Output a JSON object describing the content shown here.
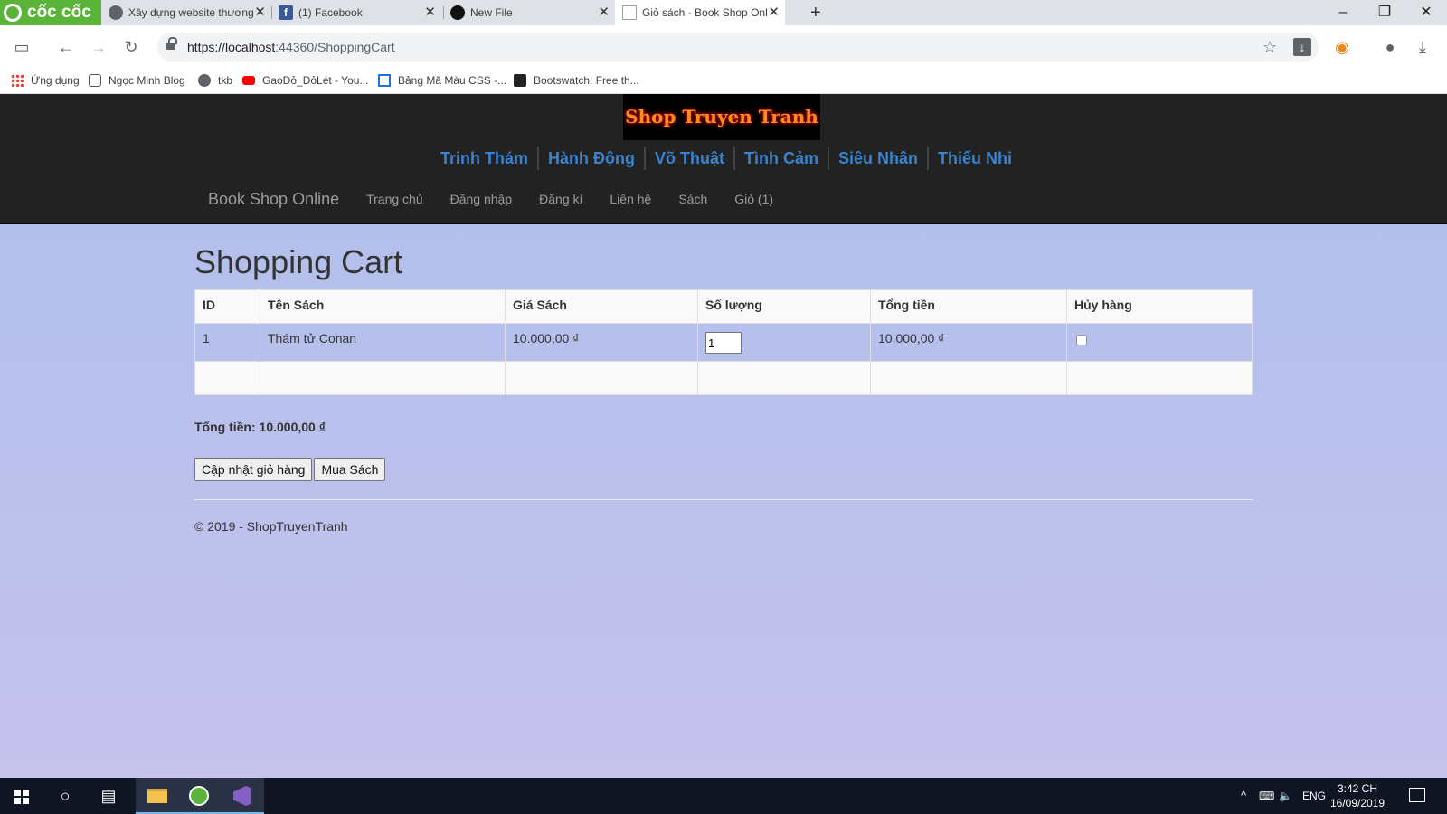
{
  "browser": {
    "brand": "cốc cốc",
    "tabs": [
      {
        "title": "Xây dựng website thương"
      },
      {
        "title": "(1) Facebook"
      },
      {
        "title": "New File"
      },
      {
        "title": "Giỏ sách - Book Shop Onl"
      }
    ],
    "url_host": "https://localhost",
    "url_rest": ":44360/ShoppingCart",
    "bookmarks": [
      {
        "label": "Ứng dụng",
        "icon": "apps-icon"
      },
      {
        "label": "Ngọc Minh Blog",
        "icon": "blog-icon"
      },
      {
        "label": "tkb",
        "icon": "globe-icon"
      },
      {
        "label": "GaoĐỏ_ĐỏLét - You...",
        "icon": "youtube-icon"
      },
      {
        "label": "Bảng Mã Màu CSS -...",
        "icon": "css-icon"
      },
      {
        "label": "Bootswatch: Free th...",
        "icon": "bootswatch-icon"
      }
    ]
  },
  "site": {
    "logo_text": "Shop Truyen Tranh",
    "categories": [
      "Trinh Thám",
      "Hành Động",
      "Võ Thuật",
      "Tình Cảm",
      "Siêu Nhân",
      "Thiếu Nhi"
    ],
    "brand": "Book Shop Online",
    "nav": [
      "Trang chủ",
      "Đăng nhập",
      "Đăng kí",
      "Liên hệ",
      "Sách",
      "Giỏ (1)"
    ]
  },
  "cart": {
    "title": "Shopping Cart",
    "headers": [
      "ID",
      "Tên Sách",
      "Giá Sách",
      "Số lượng",
      "Tổng tiền",
      "Hủy hàng"
    ],
    "rows": [
      {
        "id": "1",
        "name": "Thám tử Conan",
        "price": "10.000,00 ₫",
        "quantity": "1",
        "total": "10.000,00 ₫",
        "cancel": false
      }
    ],
    "grand_total": "Tổng tiền: 10.000,00 ₫",
    "update_button": "Cập nhật giỏ hàng",
    "buy_button": "Mua Sách"
  },
  "footer": {
    "text": "© 2019 - ShopTruyenTranh"
  },
  "taskbar": {
    "lang": "ENG",
    "time": "3:42 CH",
    "date": "16/09/2019"
  },
  "colors": {
    "navbar": "#222222",
    "category_link": "#3a83cf",
    "page_bg_top": "#aebeeb",
    "page_bg_bottom": "#c6c3ed",
    "coccoc_green": "#5bb43a"
  }
}
